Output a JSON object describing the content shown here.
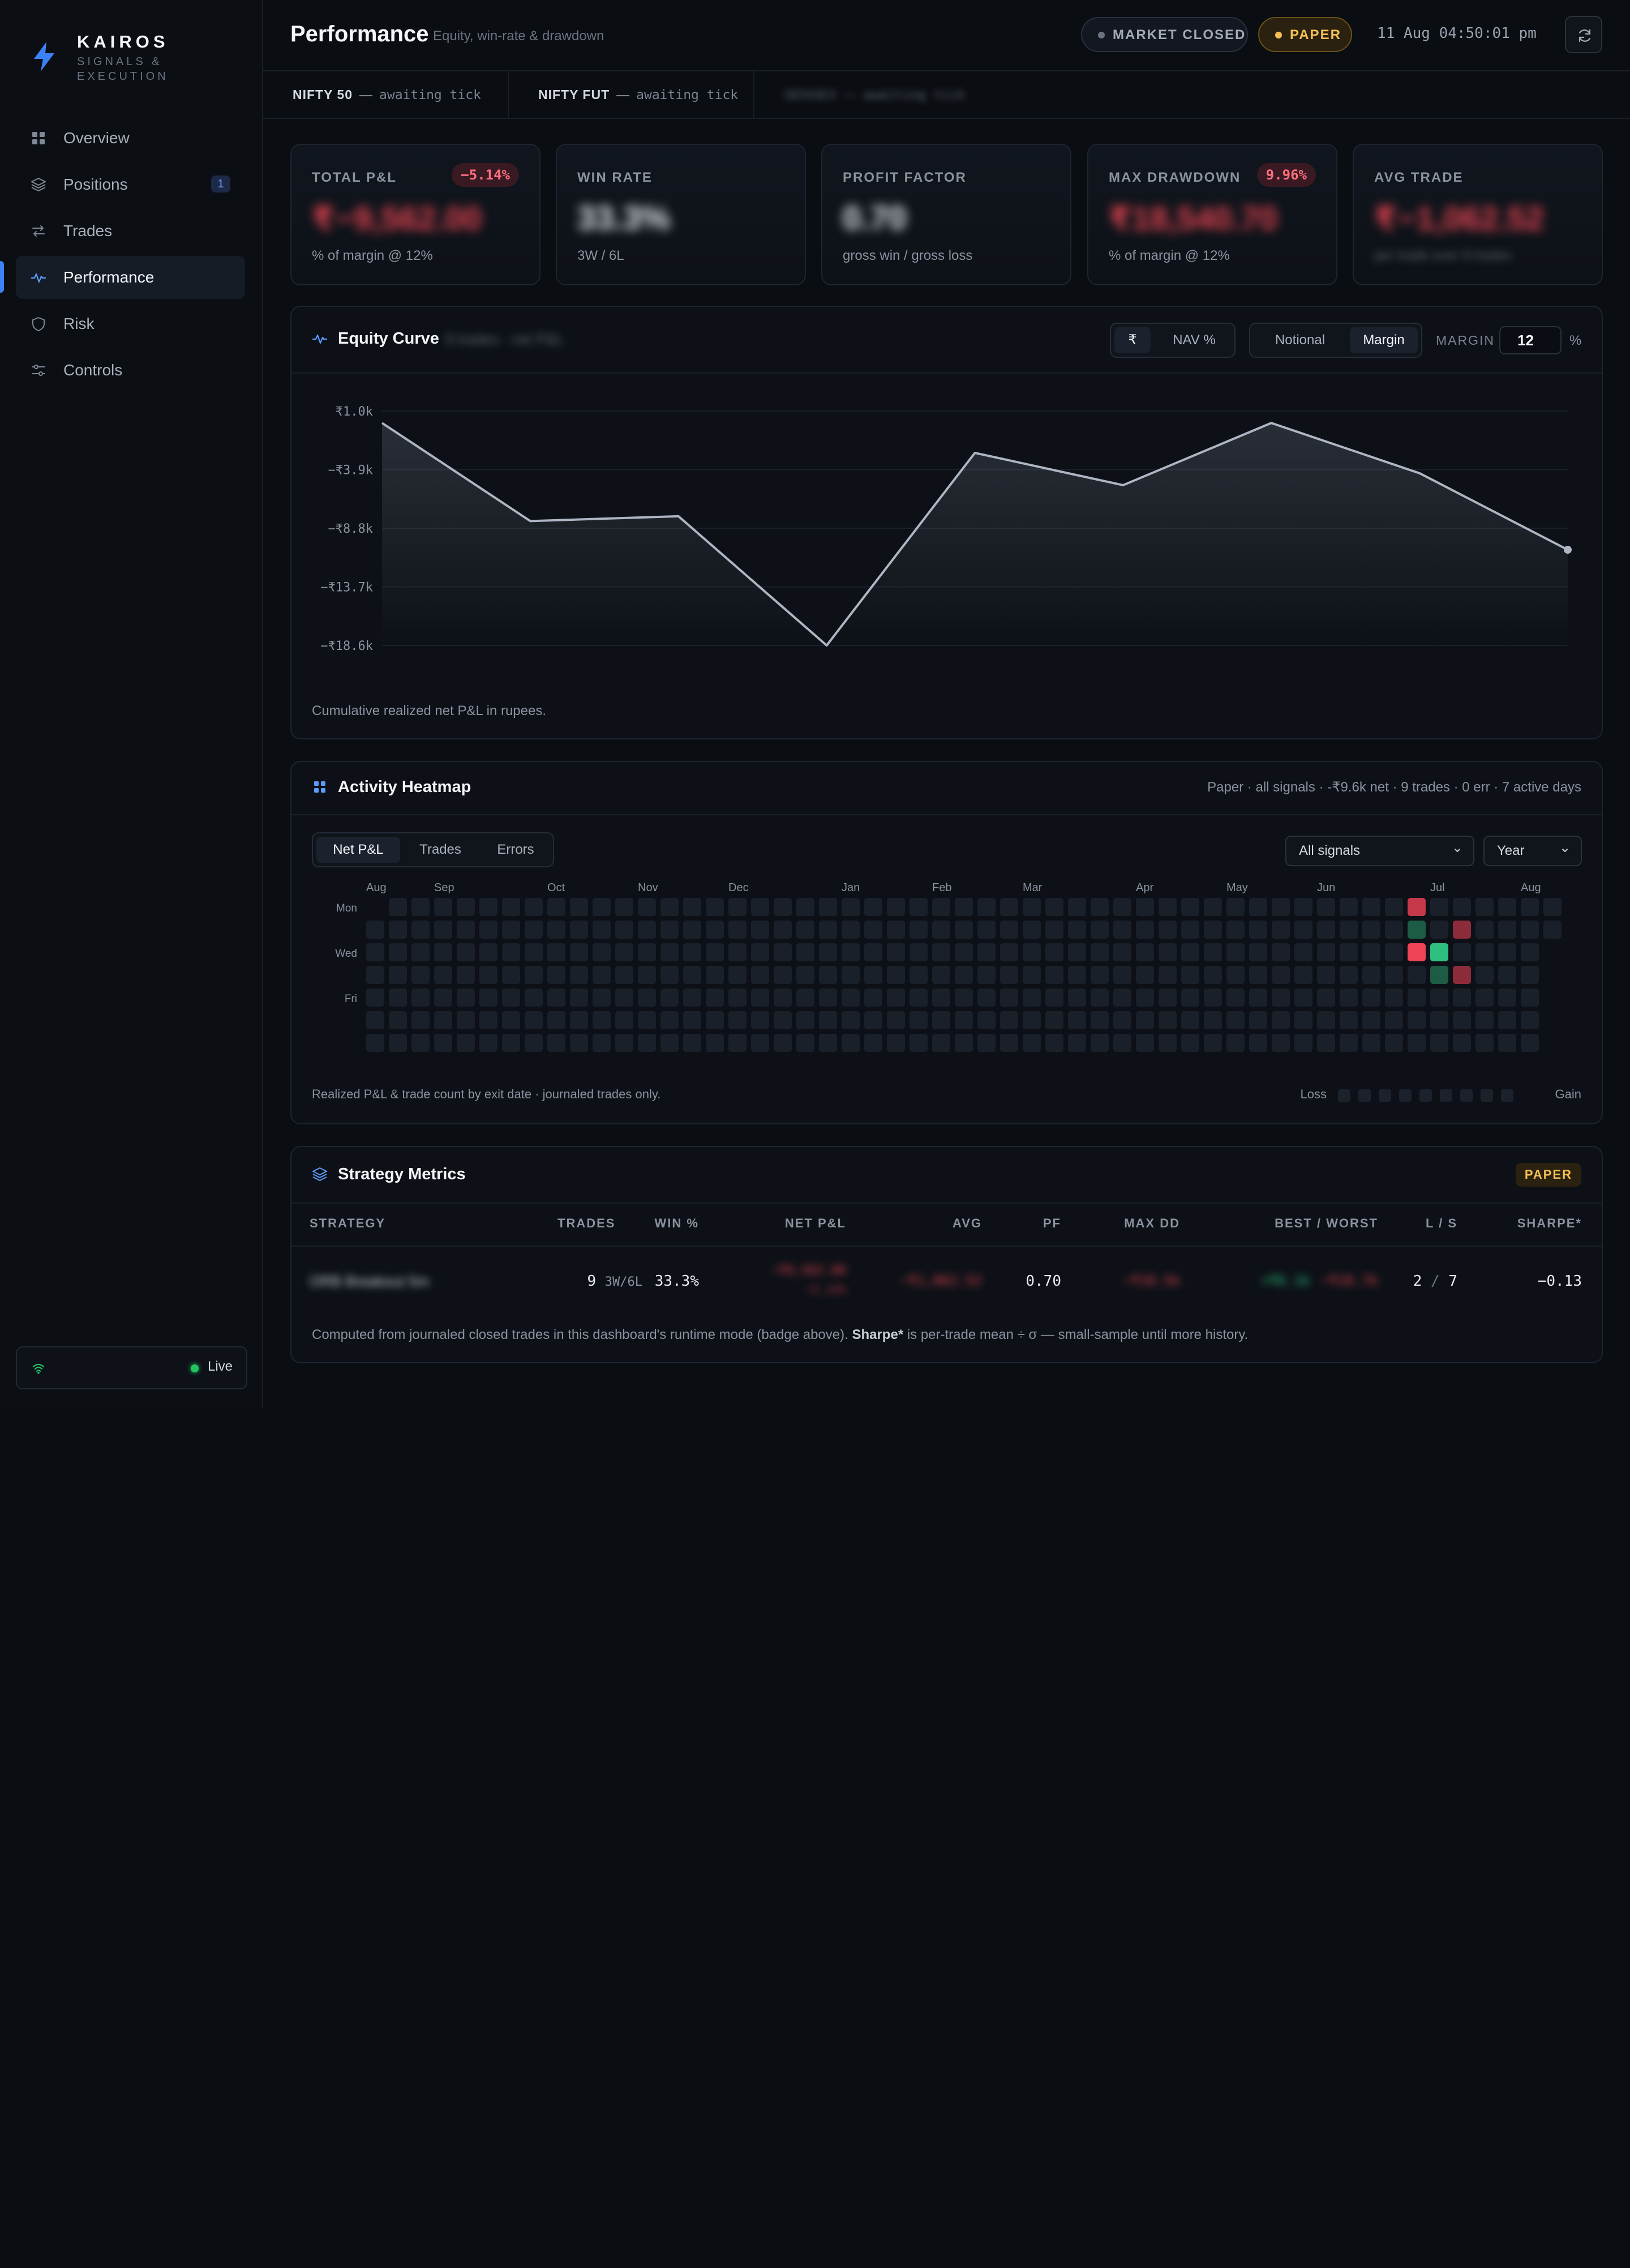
{
  "sidebar": {
    "brand": {
      "name": "KAIROS",
      "sub1": "SIGNALS &",
      "sub2": "EXECUTION"
    },
    "items": [
      {
        "label": "Overview",
        "icon": "grid-icon"
      },
      {
        "label": "Positions",
        "icon": "layers-icon",
        "badge": "1"
      },
      {
        "label": "Trades",
        "icon": "swap-icon"
      },
      {
        "label": "Performance",
        "icon": "pulse-icon",
        "active": true
      },
      {
        "label": "Risk",
        "icon": "shield-icon"
      },
      {
        "label": "Controls",
        "icon": "sliders-icon"
      }
    ],
    "connection": {
      "status": "Live"
    }
  },
  "header": {
    "title": "Performance",
    "subtitle": "Equity, win-rate & drawdown",
    "market_status": "MARKET CLOSED",
    "mode": "PAPER",
    "clock": "11 Aug 04:50:01 pm"
  },
  "ticker": [
    {
      "symbol": "NIFTY 50",
      "dash": "—",
      "status": "awaiting tick"
    },
    {
      "symbol": "NIFTY FUT",
      "dash": "—",
      "status": "awaiting tick"
    },
    {
      "symbol": "SENSEX",
      "dash": "—",
      "status": "awaiting tick"
    }
  ],
  "stats": [
    {
      "label": "TOTAL P&L",
      "badge": "−5.14%",
      "value": "₹−9,562.00",
      "note": "% of margin @ 12%"
    },
    {
      "label": "WIN RATE",
      "value": "33.3%",
      "note": "3W / 6L"
    },
    {
      "label": "PROFIT FACTOR",
      "value": "0.70",
      "note": "gross win / gross loss"
    },
    {
      "label": "MAX DRAWDOWN",
      "badge": "9.96%",
      "value": "₹18,540.70",
      "note": "% of margin @ 12%"
    },
    {
      "label": "AVG TRADE",
      "value": "₹−1,062.52",
      "note": "per trade over 9 trades"
    }
  ],
  "equity": {
    "title": "Equity Curve",
    "blurred_meta": "9 trades · net P&L",
    "unit_options": [
      "₹",
      "NAV %"
    ],
    "unit_selected": "₹",
    "mode_options": [
      "Notional",
      "Margin"
    ],
    "mode_selected": "Margin",
    "margin_label": "MARGIN",
    "margin_value": "12",
    "margin_unit": "%",
    "caption": "Cumulative realized net P&L in rupees."
  },
  "chart_data": {
    "type": "area",
    "title": "Equity Curve",
    "y_tick_labels": [
      "₹1.0k",
      "−₹3.9k",
      "−₹8.8k",
      "−₹13.7k",
      "−₹18.6k"
    ],
    "y_ticks": [
      1000,
      -3900,
      -8800,
      -13700,
      -18600
    ],
    "ylim": [
      -18600,
      1000
    ],
    "x": [
      1,
      2,
      3,
      4,
      5,
      6,
      7,
      8,
      9
    ],
    "values": [
      0,
      -8200,
      -7800,
      -18600,
      -2500,
      -5200,
      0,
      -4200,
      -10600
    ],
    "grid": true,
    "legend": "none",
    "line_color": "#aeb6c4"
  },
  "heatmap": {
    "title": "Activity Heatmap",
    "summary": "Paper · all signals · -₹9.6k net · 9 trades · 0 err · 7 active days",
    "metric_options": [
      "Net P&L",
      "Trades",
      "Errors"
    ],
    "metric_selected": "Net P&L",
    "signal_filter": "All signals",
    "range": "Year",
    "months": [
      "Aug",
      "Sep",
      "Oct",
      "Nov",
      "Dec",
      "Jan",
      "Feb",
      "Mar",
      "Apr",
      "May",
      "Jun",
      "Jul",
      "Aug"
    ],
    "month_weeks": [
      0,
      3,
      8,
      12,
      16,
      21,
      25,
      29,
      34,
      38,
      42,
      47,
      51
    ],
    "day_labels": [
      "Mon",
      "",
      "Wed",
      "",
      "Fri",
      "",
      ""
    ],
    "weeks": 53,
    "active_cells": [
      {
        "week": 46,
        "day": 0,
        "pnl": "loss-strong"
      },
      {
        "week": 46,
        "day": 1,
        "pnl": "gain-weak"
      },
      {
        "week": 46,
        "day": 2,
        "pnl": "loss-max"
      },
      {
        "week": 47,
        "day": 2,
        "pnl": "gain-max"
      },
      {
        "week": 47,
        "day": 3,
        "pnl": "gain-weak"
      },
      {
        "week": 48,
        "day": 1,
        "pnl": "loss-medium"
      },
      {
        "week": 48,
        "day": 3,
        "pnl": "loss-medium"
      }
    ],
    "caption": "Realized P&L & trade count by exit date · journaled trades only.",
    "legend_low": "Loss",
    "legend_high": "Gain",
    "colors": {
      "empty": "#1a2029",
      "loss-max": "#ef4458",
      "loss-strong": "#c4384a",
      "loss-medium": "#8c2c3b",
      "gain-max": "#2fbf7f",
      "gain-weak": "#1c5c44"
    }
  },
  "strategy": {
    "title": "Strategy Metrics",
    "badge": "PAPER",
    "columns": [
      "STRATEGY",
      "TRADES",
      "WIN %",
      "NET P&L",
      "AVG",
      "PF",
      "MAX DD",
      "BEST / WORST",
      "L / S",
      "SHARPE*"
    ],
    "row": {
      "strategy": "ORB Breakout 5m",
      "trades": "9",
      "trades_split": "3W/6L",
      "win_pct": "33.3%",
      "net_pnl": "−₹9,562.00",
      "net_pnl_pct": "−5.14%",
      "avg": "−₹1,062.52",
      "pf": "0.70",
      "max_dd": "−₹18.5k",
      "best": "+₹6.1k",
      "worst": "−₹10.7k",
      "long": "2",
      "sep": "/",
      "short": "7",
      "sharpe": "−0.13"
    },
    "footnote_pre": "Computed from journaled closed trades in this dashboard's runtime mode (badge above). ",
    "footnote_bold": "Sharpe*",
    "footnote_post": " is per-trade mean ÷ σ — small-sample until more history."
  }
}
